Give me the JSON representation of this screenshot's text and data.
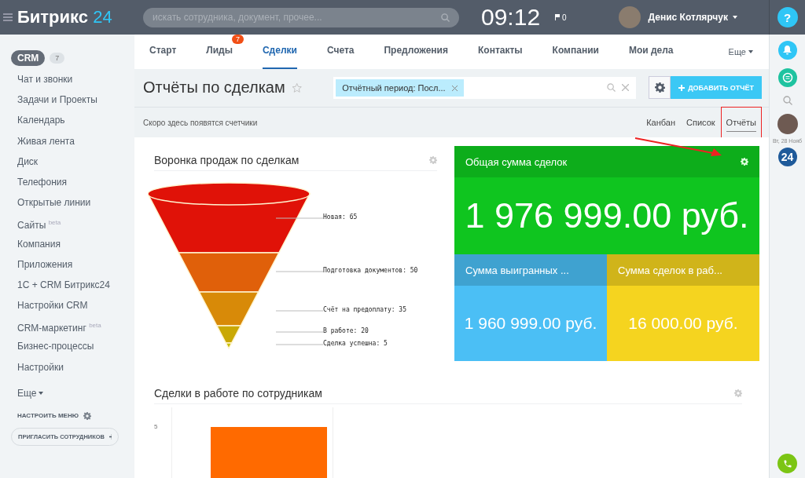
{
  "header": {
    "logo": {
      "text": "Битрикс",
      "accent": "24"
    },
    "search": {
      "placeholder": "искать сотрудника, документ, прочее..."
    },
    "time": "09:12",
    "flag_count": "0",
    "user": "Денис Котлярчук",
    "help": "?"
  },
  "sidebar": {
    "section": {
      "label": "CRM",
      "count": "7"
    },
    "items": [
      {
        "label": "Чат и звонки"
      },
      {
        "label": "Задачи и Проекты"
      },
      {
        "label": "Календарь"
      },
      {
        "label": "Живая лента"
      },
      {
        "label": "Диск"
      },
      {
        "label": "Телефония"
      },
      {
        "label": "Открытые линии"
      },
      {
        "label": "Сайты",
        "sup": "beta"
      },
      {
        "label": "Компания"
      },
      {
        "label": "Приложения"
      },
      {
        "label": "1С + CRM Битрикс24"
      },
      {
        "label": "Настройки CRM"
      },
      {
        "label": "CRM-маркетинг",
        "sup": "beta"
      },
      {
        "label": "Бизнес-процессы"
      },
      {
        "label": "Настройки"
      }
    ],
    "more": "Еще",
    "configure": "НАСТРОИТЬ МЕНЮ",
    "invite": "ПРИГЛАСИТЬ СОТРУДНИКОВ"
  },
  "tabs": [
    {
      "label": "Старт",
      "selected": false
    },
    {
      "label": "Лиды",
      "selected": false,
      "badge": "7"
    },
    {
      "label": "Сделки",
      "selected": true
    },
    {
      "label": "Счета",
      "selected": false
    },
    {
      "label": "Предложения",
      "selected": false
    },
    {
      "label": "Контакты",
      "selected": false
    },
    {
      "label": "Компании",
      "selected": false
    },
    {
      "label": "Мои дела",
      "selected": false
    }
  ],
  "tabs_more": "Еще",
  "page": {
    "title": "Отчёты по сделкам",
    "filter_chip": "Отчётный период: Посл...",
    "add_button": "ДОБАВИТЬ ОТЧЁТ",
    "counters_note": "Скоро здесь появятся счетчики",
    "views": [
      {
        "label": "Канбан",
        "selected": false,
        "highlighted": false
      },
      {
        "label": "Список",
        "selected": false,
        "highlighted": false
      },
      {
        "label": "Отчёты",
        "selected": true,
        "highlighted": true
      }
    ]
  },
  "funnel": {
    "title": "Воронка продаж по сделкам",
    "stages": [
      {
        "label": "Новая: 65",
        "color": "#e01208"
      },
      {
        "label": "Подготовка документов: 50",
        "color": "#e0600a"
      },
      {
        "label": "Счёт на предоплату: 35",
        "color": "#d88a08"
      },
      {
        "label": "В работе: 20",
        "color": "#c9a804"
      },
      {
        "label": "Сделка успешна: 5",
        "color": "#c9c004"
      }
    ]
  },
  "sums": {
    "title": "Общая сумма сделок",
    "total": "1 976 999.00 руб.",
    "color": "#0fc51f",
    "tiles": [
      {
        "title": "Сумма выигранных ...",
        "value": "1 960 999.00 руб.",
        "color": "#4bbff5"
      },
      {
        "title": "Сумма сделок в раб...",
        "value": "16 000.00 руб.",
        "color": "#f5d41f"
      }
    ]
  },
  "employees": {
    "title": "Сделки в работе по сотрудникам",
    "axis_label": "5"
  },
  "right_bar": {
    "date": "Вт, 28 Нояб",
    "badge": "24"
  }
}
